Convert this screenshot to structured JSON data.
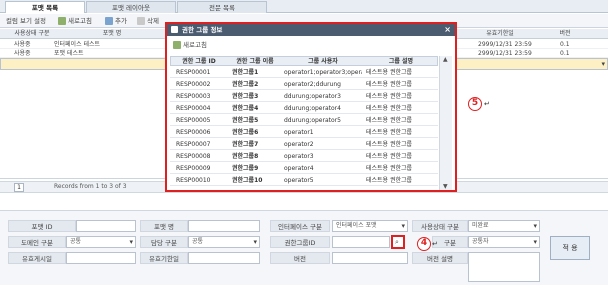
{
  "tabs": [
    {
      "label": "포맷 목록"
    },
    {
      "label": "포맷 레이아웃"
    },
    {
      "label": "전문 목록"
    }
  ],
  "toolbar": {
    "view_settings": "컬럼 보기 설정",
    "refresh": "새로고침",
    "add": "추가",
    "delete": "삭제"
  },
  "grid": {
    "headers": [
      "사용상태 구분",
      "포맷 명",
      "유효기한일",
      "버전"
    ],
    "rows": [
      {
        "status": "사용중",
        "name": "인터페이스 테스트",
        "expiry": "2999/12/31 23:59",
        "version": "0.1"
      },
      {
        "status": "사용중",
        "name": "포맷 테스트",
        "expiry": "2999/12/31 23:59",
        "version": "0.1"
      }
    ]
  },
  "pager": {
    "page": "1",
    "records": "Records from 1 to 3 of 3"
  },
  "form": {
    "format_id_label": "포맷 ID",
    "format_name_label": "포맷 명",
    "interface_type_label": "인터페이스 구분",
    "interface_type_value": "인터페이스 포맷",
    "status_type_label": "사용상태 구분",
    "status_type_value": "미완료",
    "domain_type_label": "도메인 구분",
    "domain_type_value": "공통",
    "owner_type_label": "담당 구분",
    "owner_type_value": "공통",
    "perm_group_id_label": "권한그룹ID",
    "usage_type_label": "구분",
    "usage_type_value": "공통자",
    "post_date_label": "유효게시일",
    "expiry_date_label": "유효기한일",
    "version_label": "버전",
    "version_desc_label": "버전 설명",
    "apply_button": "적 용"
  },
  "dialog": {
    "title": "권한 그룹 정보",
    "refresh": "새로고침",
    "headers": [
      "권한 그룹 ID",
      "권한 그룹 이름",
      "그룹 사용자",
      "그룹 설명"
    ],
    "rows": [
      {
        "id": "RESP00001",
        "name": "권한그룹1",
        "users": "operator1;operator3;operat",
        "desc": "테스트용 권한그룹"
      },
      {
        "id": "RESP00002",
        "name": "권한그룹2",
        "users": "operator2;ddurung",
        "desc": "테스트용 권한그룹"
      },
      {
        "id": "RESP00003",
        "name": "권한그룹3",
        "users": "ddurung;operator3",
        "desc": "테스트용 권한그룹"
      },
      {
        "id": "RESP00004",
        "name": "권한그룹4",
        "users": "ddurung;operator4",
        "desc": "테스트용 권한그룹"
      },
      {
        "id": "RESP00005",
        "name": "권한그룹5",
        "users": "ddurung;operator5",
        "desc": "테스트용 권한그룹"
      },
      {
        "id": "RESP00006",
        "name": "권한그룹6",
        "users": "operator1",
        "desc": "테스트용 권한그룹"
      },
      {
        "id": "RESP00007",
        "name": "권한그룹7",
        "users": "operator2",
        "desc": "테스트용 권한그룹"
      },
      {
        "id": "RESP00008",
        "name": "권한그룹8",
        "users": "operator3",
        "desc": "테스트용 권한그룹"
      },
      {
        "id": "RESP00009",
        "name": "권한그룹9",
        "users": "operator4",
        "desc": "테스트용 권한그룹"
      },
      {
        "id": "RESP00010",
        "name": "권한그룹10",
        "users": "operator5",
        "desc": "테스트용 권한그룹"
      }
    ]
  },
  "annotations": {
    "callout_4": "4",
    "callout_5": "5",
    "return_mark": "↵"
  },
  "colors": {
    "highlight": "#e02020",
    "title_bar": "#4b5b70",
    "selected_row": "#fdf0c4"
  }
}
